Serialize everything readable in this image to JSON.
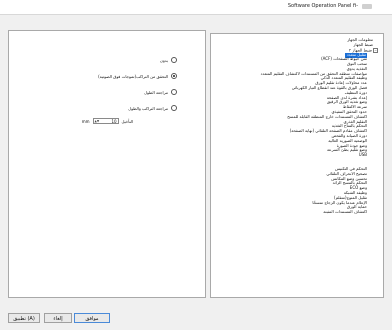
{
  "window": {
    "title": "Software Operation Panel fi-"
  },
  "options": {
    "items": [
      {
        "label": "بدون",
        "selected": false
      },
      {
        "label": "التحقق من التراكب(تموجات فوق الصوتية)",
        "selected": true
      },
      {
        "label": "مراجعة الطول",
        "selected": false
      },
      {
        "label": "مراجعة التراكب والطول",
        "selected": false
      }
    ],
    "delay_label": "التأخيل",
    "delay_value": "10",
    "delay_unit": "mm"
  },
  "tree": {
    "items": [
      {
        "label": "معلومات الجهاز",
        "level": 1,
        "expander": ""
      },
      {
        "label": "ضبط الجهاز",
        "level": 1,
        "expander": ""
      },
      {
        "label": "ضبط الجهاز ٢",
        "level": 1,
        "expander": "−"
      },
      {
        "label": "تقليل متعدد",
        "level": 2,
        "selected": true
      },
      {
        "label": "متن خيوط الصفحات (ACF)",
        "level": 2
      },
      {
        "label": "سحب التوق",
        "level": 2
      },
      {
        "label": "التغذية يدوي",
        "level": 2
      },
      {
        "label": "مواصفات منطقة التحقق من المستندات لاكتشاف التقليم المتعدد",
        "level": 2
      },
      {
        "label": "وظيفة التقليم المتعدد الذكي",
        "level": 2
      },
      {
        "label": "عدد محاولات إعادة تقليم الورق",
        "level": 2
      },
      {
        "label": "فصل الورق بالقوة عند انقطاع التيار الكهربائي",
        "level": 2
      },
      {
        "label": "دورة التنظيف",
        "level": 2
      },
      {
        "label": "إعداد بشرة لدى الصفحة",
        "level": 2
      },
      {
        "label": "وضع تغذية الورق الرقيق",
        "level": 2
      },
      {
        "label": "سرعة الالتقاط",
        "level": 2
      },
      {
        "label": "حدود التحقق التنفيذي",
        "level": 2
      },
      {
        "label": "اكتشاف المستندات خارج المنطقة القابلة للمسح",
        "level": 2
      },
      {
        "label": "التقليم الغذري",
        "level": 2
      },
      {
        "label": "التحكم بالمتاح التغذية",
        "level": 2
      },
      {
        "label": "اكتشاف مقادم الصفحة التلقائي (نهاية الصفحة)",
        "level": 2
      },
      {
        "label": "دورة الصيانة والفحص",
        "level": 2
      },
      {
        "label": "الوضعية الصورية العالية",
        "level": 2
      },
      {
        "label": "وضع جودة الصورة",
        "level": 2
      },
      {
        "label": "وضع تقليم بطئ السرعة",
        "level": 2
      },
      {
        "label": "USB",
        "level": 2
      },
      {
        "label": "",
        "level": 0
      },
      {
        "label": "",
        "level": 0
      },
      {
        "label": "التحكم في التكنيس",
        "level": 2
      },
      {
        "label": "تصحيح الانحراف التلقائي",
        "level": 2
      },
      {
        "label": "تحسين وضع المكانس",
        "level": 2
      },
      {
        "label": "التحكم بالمسح الزائد",
        "level": 2
      },
      {
        "label": "وضع ECO",
        "level": 2
      },
      {
        "label": "وظيفة الشبكة",
        "level": 2
      },
      {
        "label": "تقليل المتوج(متقلم)",
        "level": 2
      },
      {
        "label": "الإعلام عندما يكون الزجاج متسخًا",
        "level": 2
      },
      {
        "label": "حماية الورق",
        "level": 2
      },
      {
        "label": "اكتشاف المستندات المثبتة",
        "level": 2
      }
    ]
  },
  "buttons": {
    "ok": "موافق",
    "cancel": "إلغاء",
    "apply": "تطبيق (A)"
  }
}
